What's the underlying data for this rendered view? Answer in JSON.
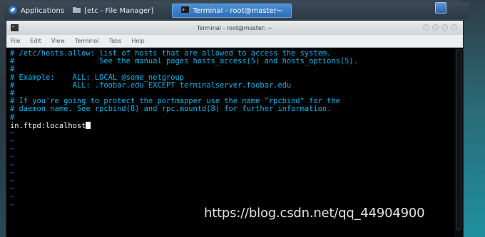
{
  "panel": {
    "applications_label": "Applications",
    "file_manager_label": "[etc - File Manager]",
    "terminal_task_label": "Terminal - root@master~"
  },
  "window": {
    "title": "Terminal - root@master: ~",
    "menu": [
      "File",
      "Edit",
      "View",
      "Terminal",
      "Tabs",
      "Help"
    ]
  },
  "terminal": {
    "lines": [
      "# /etc/hosts.allow: list of hosts that are allowed to access the system.",
      "#                   See the manual pages hosts_access(5) and hosts_options(5).",
      "#",
      "# Example:    ALL: LOCAL @some_netgroup",
      "#             ALL: .foobar.edu EXCEPT terminalserver.foobar.edu",
      "#",
      "# If you're going to protect the portmapper use the name \"rpcbind\" for the",
      "# daemon name. See rpcbind(8) and rpc.mountd(8) for further information.",
      "#",
      "in.ftpd:localhost"
    ],
    "tilde": "~"
  },
  "watermark": "https://blog.csdn.net/qq_44904900"
}
